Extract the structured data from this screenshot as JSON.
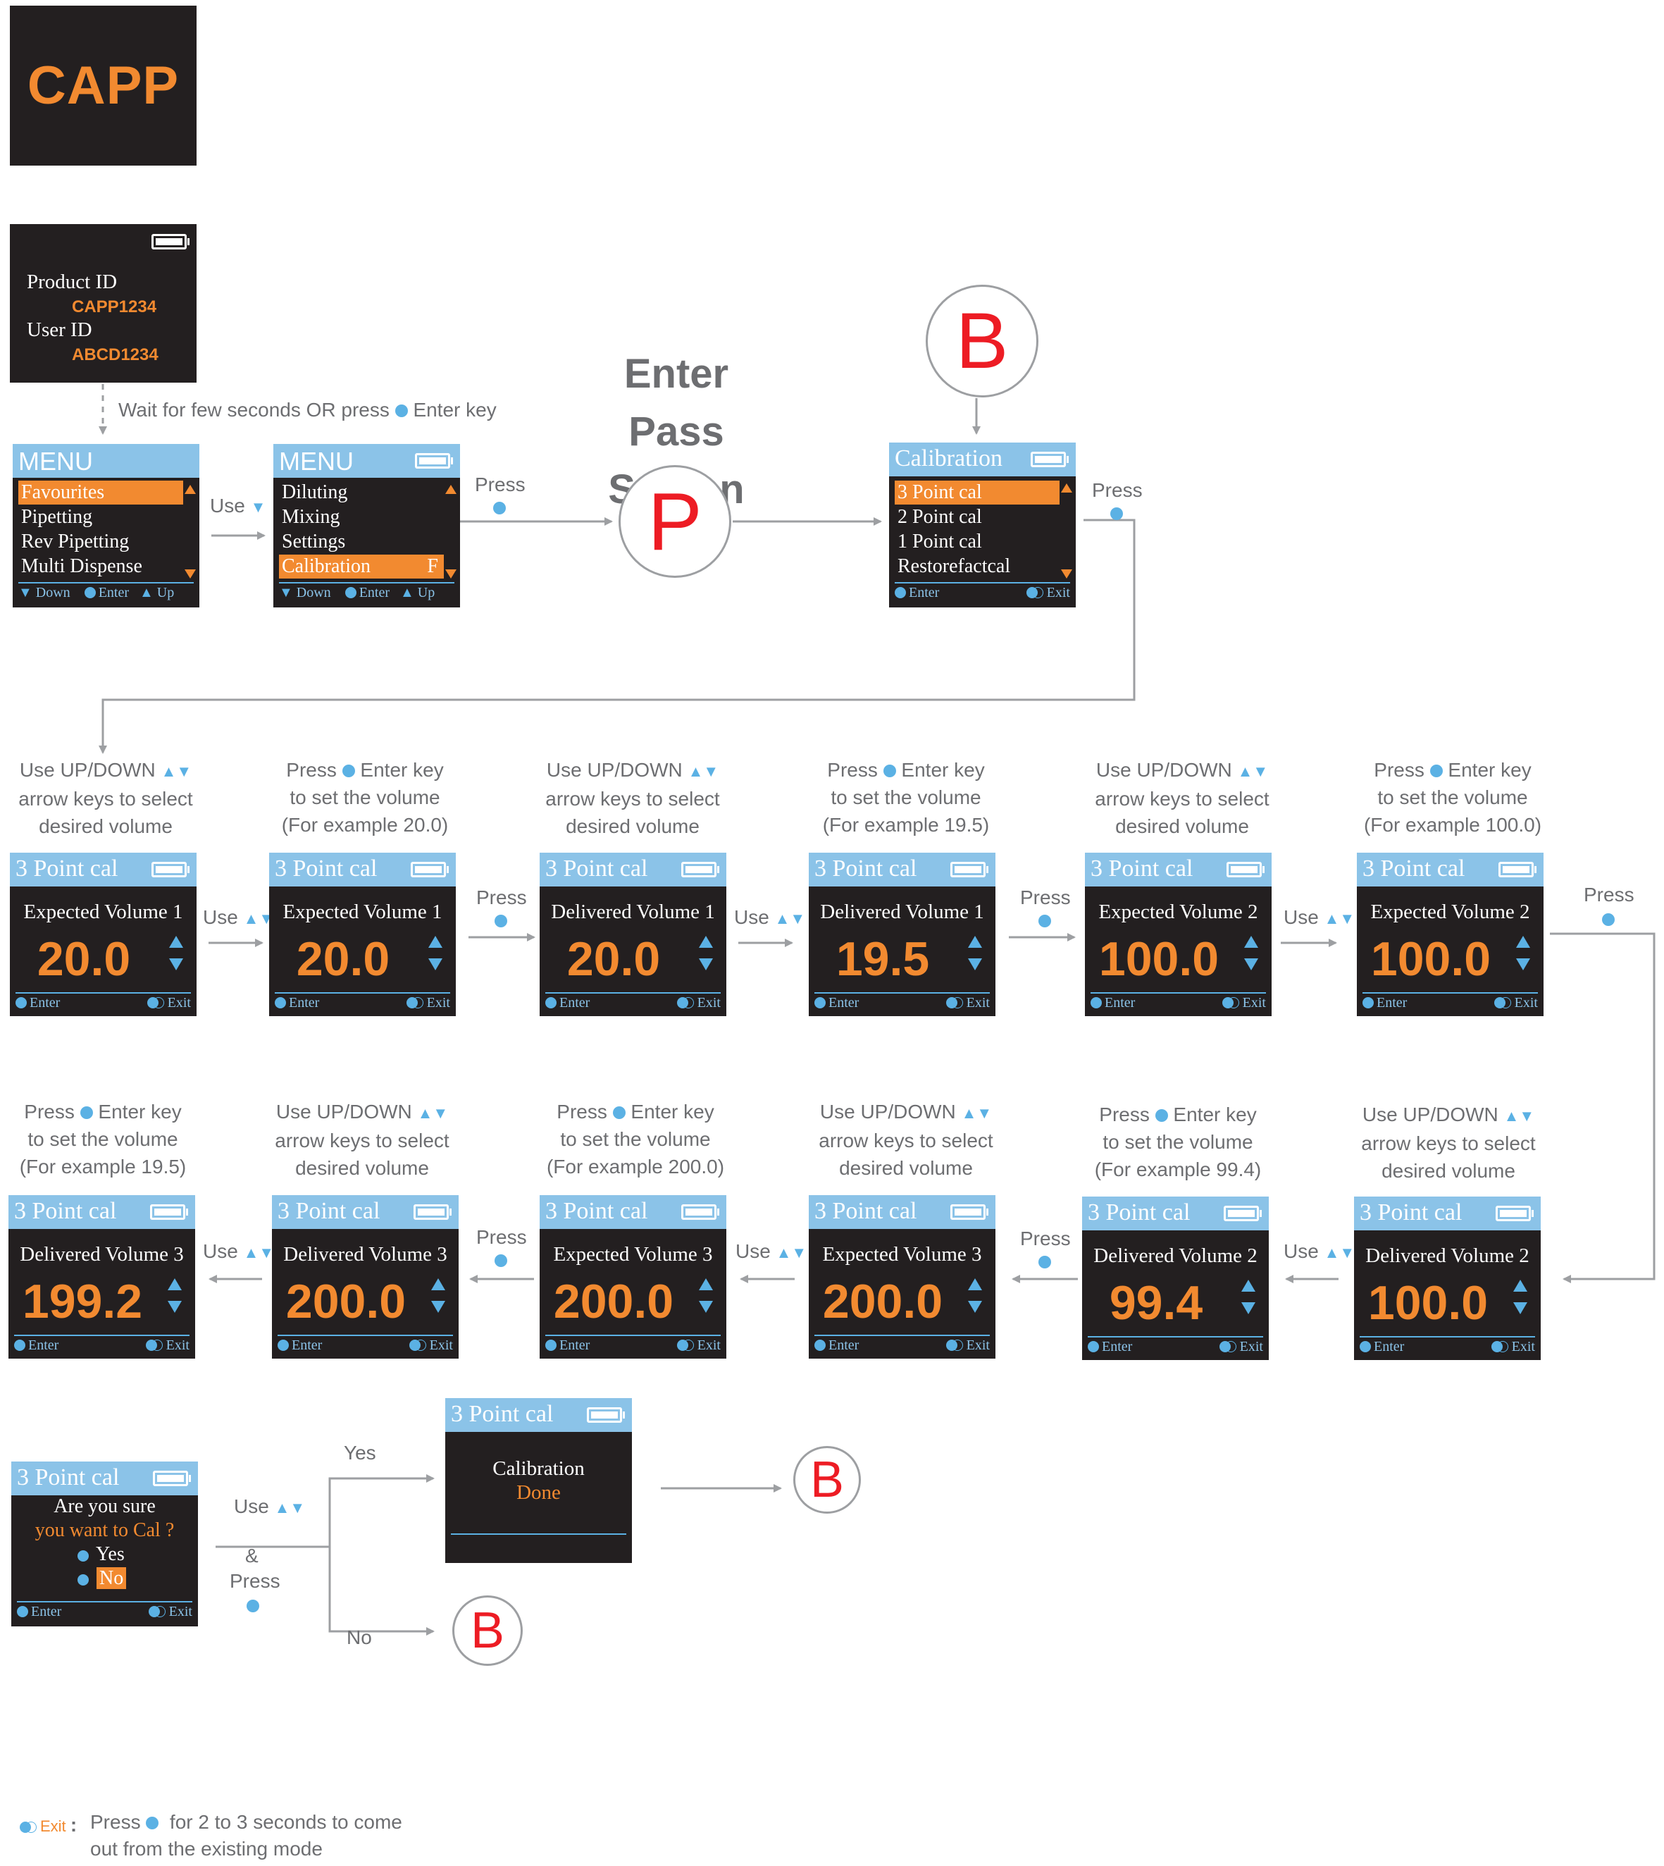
{
  "logo": {
    "text": "CAPP"
  },
  "product_screen": {
    "product_label": "Product  ID",
    "product_value": "CAPP1234",
    "user_label": "User ID",
    "user_value": "ABCD1234"
  },
  "wait_caption": {
    "text": "Wait for few seconds OR press",
    "key": "Enter key"
  },
  "menu1": {
    "title": "MENU",
    "items": [
      "Favourites",
      "Pipetting",
      "Rev Pipetting",
      "Multi Dispense"
    ],
    "footer": {
      "down": "Down",
      "enter": "Enter",
      "up": "Up"
    }
  },
  "menu2": {
    "title": "MENU",
    "items": [
      "Diluting",
      "Mixing",
      "Settings",
      "Calibration"
    ],
    "badge": "F",
    "footer": {
      "down": "Down",
      "enter": "Enter",
      "up": "Up"
    }
  },
  "calibration_menu": {
    "title": "Calibration",
    "items": [
      "3 Point cal",
      "2 Point cal",
      "1 Point cal",
      "Restorefactcal"
    ],
    "footer": {
      "enter": "Enter",
      "exit": "Exit"
    }
  },
  "pass_screen": {
    "line1": "Enter",
    "line2": "Pass Screen",
    "symbol": "P"
  },
  "b_symbol": "B",
  "labels": {
    "use": "Use",
    "press": "Press",
    "yes": "Yes",
    "no": "No",
    "and": "&"
  },
  "captions": {
    "use_updown_1": "Use UP/DOWN",
    "use_updown_2": "arrow keys to select",
    "use_updown_3": "desired volume",
    "press_enter_1": "Press",
    "press_enter_key": "Enter key",
    "press_enter_2": "to set the volume"
  },
  "examples": [
    "(For example 20.0)",
    "(For example 19.5)",
    "(For example 100.0)",
    "(For example 19.5)",
    "(For example 200.0)",
    "(For example 99.4)"
  ],
  "cal_screens": [
    {
      "title": "3 Point cal",
      "label": "Expected Volume 1",
      "value": "20.0"
    },
    {
      "title": "3 Point cal",
      "label": "Expected Volume 1",
      "value": "20.0"
    },
    {
      "title": "3 Point cal",
      "label": "Delivered Volume 1",
      "value": "20.0"
    },
    {
      "title": "3 Point cal",
      "label": "Delivered Volume 1",
      "value": "19.5"
    },
    {
      "title": "3 Point cal",
      "label": "Expected Volume 2",
      "value": "100.0"
    },
    {
      "title": "3 Point cal",
      "label": "Expected Volume 2",
      "value": "100.0"
    },
    {
      "title": "3 Point cal",
      "label": "Delivered Volume 3",
      "value": "199.2"
    },
    {
      "title": "3 Point cal",
      "label": "Delivered Volume 3",
      "value": "200.0"
    },
    {
      "title": "3 Point cal",
      "label": "Expected Volume 3",
      "value": "200.0"
    },
    {
      "title": "3 Point cal",
      "label": "Expected Volume 3",
      "value": "200.0"
    },
    {
      "title": "3 Point cal",
      "label": "Delivered Volume 2",
      "value": "99.4"
    },
    {
      "title": "3 Point cal",
      "label": "Delivered Volume 2",
      "value": "100.0"
    }
  ],
  "screen_footer": {
    "enter": "Enter",
    "exit": "Exit"
  },
  "confirm_screen": {
    "title": "3 Point cal",
    "line1": "Are you sure",
    "line2": "you want to Cal ?",
    "yes": "Yes",
    "no": "No"
  },
  "done_screen": {
    "title": "3 Point cal",
    "line1": "Calibration",
    "line2": "Done"
  },
  "legend": {
    "exit": "Exit",
    "colon": ":",
    "press": "Press",
    "text1": "for 2 to 3 seconds to come",
    "text2": "out from the existing mode"
  },
  "colors": {
    "orange": "#f28a30",
    "blue": "#5bb1e4",
    "header": "#8bc3e8",
    "screen": "#231f20",
    "red": "#ed1c24",
    "gray": "#6d6e71"
  }
}
